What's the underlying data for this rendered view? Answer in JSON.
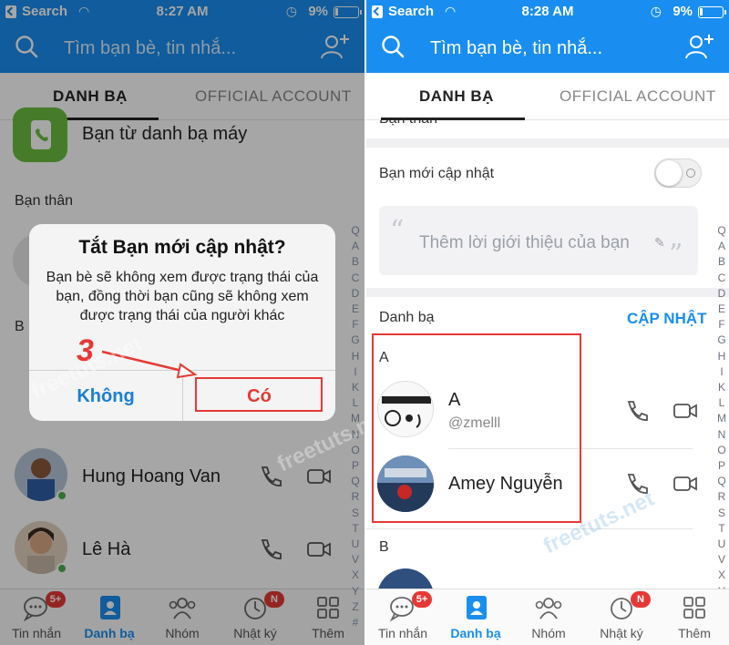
{
  "status_left": {
    "carrier": "Search",
    "time": "8:27 AM",
    "battery": "9%"
  },
  "status_right": {
    "carrier": "Search",
    "time": "8:28 AM",
    "battery": "9%"
  },
  "search_placeholder": "Tìm bạn bè, tin nhắ...",
  "tabs": {
    "contacts": "DANH BẠ",
    "official": "OFFICIAL ACCOUNT"
  },
  "left": {
    "phonebook_label": "Bạn từ danh bạ máy",
    "close_friends_label": "Bạn thân",
    "partial_label": "B",
    "contacts": [
      {
        "name": "Hung Hoang Van"
      },
      {
        "name": "Lê Hà"
      }
    ],
    "dialog": {
      "title": "Tắt Bạn mới cập nhật?",
      "message": "Bạn bè sẽ không xem được trạng thái của bạn, đồng thời bạn cũng sẽ không xem được trạng thái của người khác",
      "cancel": "Không",
      "confirm": "Có"
    },
    "step_number": "3"
  },
  "right": {
    "partial_header": "Bạn thân",
    "new_update_label": "Bạn mới cập nhật",
    "intro_placeholder": "Thêm lời giới thiệu của bạn",
    "phonebook_label": "Danh bạ",
    "update_link": "CẬP NHẬT",
    "group_a": "A",
    "group_b": "B",
    "contacts": [
      {
        "name": "A",
        "handle": "@zmelll"
      },
      {
        "name": "Amey Nguyễn"
      }
    ]
  },
  "alphabet": [
    "Q",
    "A",
    "B",
    "C",
    "D",
    "E",
    "F",
    "G",
    "H",
    "I",
    "K",
    "L",
    "M",
    "N",
    "O",
    "P",
    "Q",
    "R",
    "S",
    "T",
    "U",
    "V",
    "X",
    "Y",
    "Z",
    "#"
  ],
  "nav": [
    {
      "label": "Tin nhắn",
      "badge": "5+",
      "icon": "chat-icon"
    },
    {
      "label": "Danh bạ",
      "badge": "",
      "icon": "contacts-icon"
    },
    {
      "label": "Nhóm",
      "badge": "",
      "icon": "group-icon"
    },
    {
      "label": "Nhật ký",
      "badge": "N",
      "icon": "clock-icon"
    },
    {
      "label": "Thêm",
      "badge": "",
      "icon": "grid-icon"
    }
  ],
  "watermark": "freetuts.net",
  "colors": {
    "accent": "#1a8ef0",
    "highlight": "#e53935",
    "online": "#4caf50"
  }
}
